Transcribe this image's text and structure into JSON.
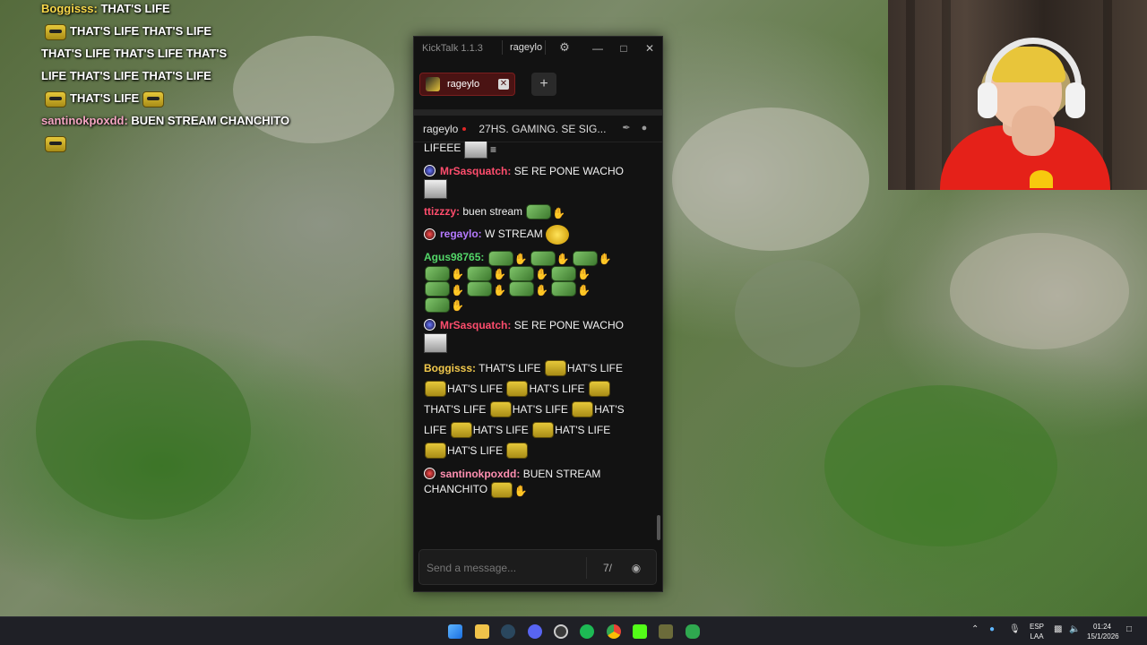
{
  "overlay": {
    "lines": [
      {
        "user": "Boggisss:",
        "text": "THAT'S LIFE"
      },
      {
        "text": "THAT'S LIFE  THAT'S LIFE"
      },
      {
        "text": "THAT'S LIFE  THAT'S LIFE  THAT'S"
      },
      {
        "text": "LIFE  THAT'S LIFE  THAT'S LIFE"
      },
      {
        "text": "THAT'S LIFE"
      },
      {
        "user": "santinokpoxdd:",
        "text": "BUEN STREAM CHANCHITO"
      }
    ]
  },
  "kicktalk": {
    "app_title": "KickTalk 1.1.3",
    "titlebar_user": "rageylo",
    "tab": {
      "label": "rageylo"
    },
    "chat_header": {
      "user": "rageylo",
      "title": "27HS. GAMING. SE SIG..."
    },
    "messages": {
      "partial": {
        "text": "LIFEEE"
      },
      "m1": {
        "user": "MrSasquatch:",
        "text": "SE RE PONE WACHO"
      },
      "m2": {
        "user": "ttizzzy:",
        "text": "buen stream"
      },
      "m3": {
        "user": "regaylo:",
        "text": "W STREAM"
      },
      "m4": {
        "user": "Agus98765:"
      },
      "m5": {
        "user": "MrSasquatch:",
        "text": "SE RE PONE WACHO"
      },
      "m6": {
        "user": "Boggisss:",
        "t1": "THAT'S LIFE",
        "t2": "HAT'S LIFE",
        "t3": "HAT'S LIFE",
        "t4": "HAT'S LIFE",
        "t5": "THAT'S LIFE",
        "t6": "HAT'S LIFE",
        "t7": "HAT'S",
        "t8": "LIFE",
        "t9": "HAT'S LIFE",
        "t10": "HAT'S LIFE",
        "t11": "HAT'S LIFE"
      },
      "m7": {
        "user": "santinokpoxdd:",
        "text": "BUEN STREAM CHANCHITO"
      }
    },
    "input": {
      "placeholder": "Send a message..."
    }
  },
  "taskbar": {
    "lang": [
      "ESP",
      "LAA"
    ],
    "time": "01:24",
    "date": "15/1/2026"
  },
  "colors": {
    "app_bg": "#121212",
    "tab_active": "#4a1313",
    "user_red": "#ff4d6d",
    "user_yellow": "#f2c94c",
    "user_green": "#53d769",
    "user_purple": "#b57aff",
    "user_pink": "#ff8fb1",
    "user_magenta": "#e060ff"
  }
}
